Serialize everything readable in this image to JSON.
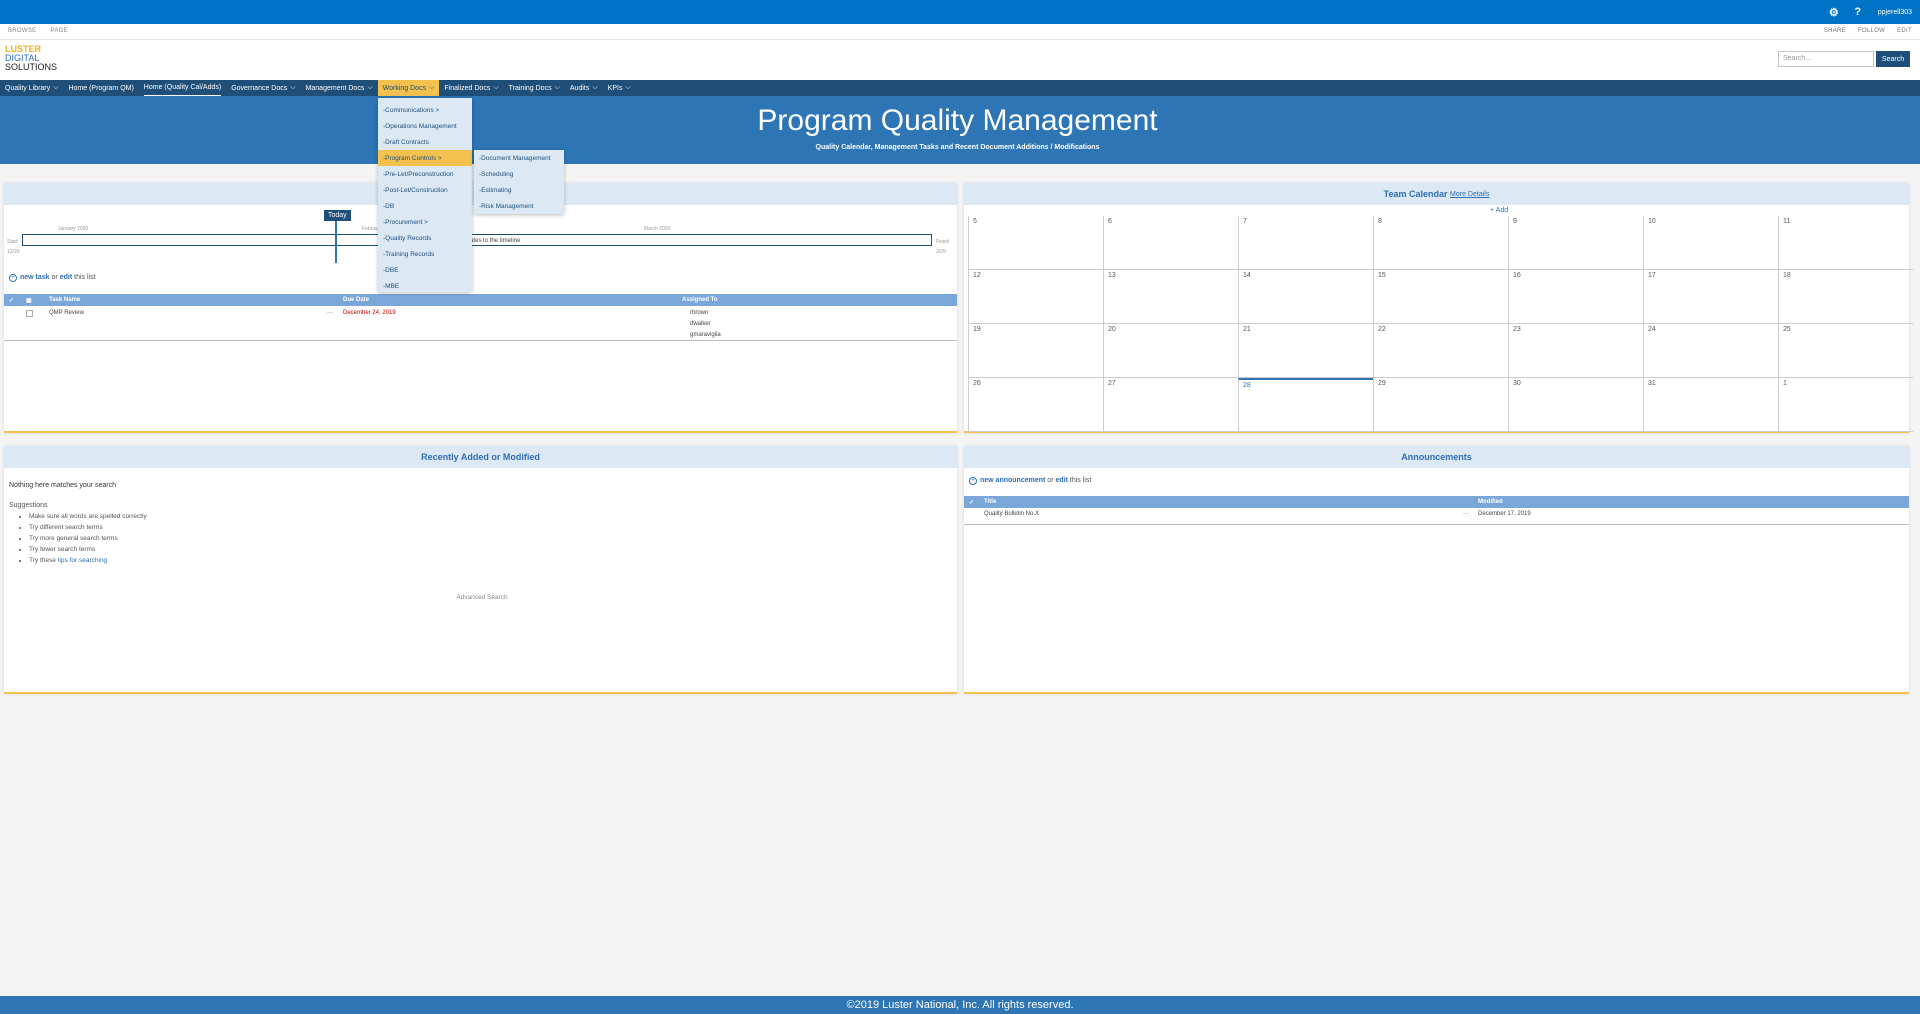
{
  "suite": {
    "settings_icon": "gear-icon",
    "help_icon": "?",
    "user": "ppjerell303"
  },
  "ribbon": {
    "tabs": [
      "BROWSE",
      "PAGE"
    ],
    "actions": [
      "SHARE",
      "FOLLOW",
      "EDIT"
    ]
  },
  "logo": {
    "line1": "LUSTER",
    "line2": "DIGITAL",
    "line3": "SOLUTIONS"
  },
  "search": {
    "placeholder": "Search...",
    "button": "Search"
  },
  "nav": {
    "items": [
      {
        "label": "Quality Library",
        "chevron": true
      },
      {
        "label": "Home (Program QM)",
        "chevron": false
      },
      {
        "label": "Home (Quality Cal/Adds)",
        "chevron": false
      },
      {
        "label": "Governance Docs",
        "chevron": true
      },
      {
        "label": "Management Docs",
        "chevron": true
      },
      {
        "label": "Working Docs",
        "chevron": true
      },
      {
        "label": "Finalized Docs",
        "chevron": true
      },
      {
        "label": "Training Docs",
        "chevron": true
      },
      {
        "label": "Audits",
        "chevron": true
      },
      {
        "label": "KPIs",
        "chevron": true
      }
    ]
  },
  "banner": {
    "title": "Program Quality Management",
    "subtitle": "Quality Calendar, Management Tasks and Recent Document Additions / Modifications"
  },
  "dropdown": {
    "items": [
      "-Communications >",
      "-Operations Management",
      "-Draft Contracts",
      "-Program Controls >",
      "-Pre-Let/Preconstruction",
      "-Post-Let/Construction",
      "-DB",
      "-Procurement >",
      "-Quality Records",
      "-Training Records",
      "-DBE",
      "-MBE"
    ],
    "highlighted": "-Program Controls >"
  },
  "submenu": {
    "items": [
      "-Document Management",
      "-Scheduling",
      "-Estimating",
      "-Risk Management"
    ]
  },
  "tasks": {
    "timeline": {
      "today": "Today",
      "months": [
        "January 2020",
        "February",
        "March 2020"
      ],
      "start_label": "Start",
      "start_date": "12/29",
      "finish_label": "Finish",
      "finish_date": "3/29",
      "hint": "ates to the timeline"
    },
    "new_task": "new task",
    "or": "or",
    "edit": "edit",
    "this_list": "this list",
    "columns": [
      "Task Name",
      "Due Date",
      "Assigned To"
    ],
    "rows": [
      {
        "name": "QMP Review",
        "dots": "···",
        "due": "December 24, 2019",
        "assigned": [
          "rbrown",
          "dwalker",
          "gmaravigila"
        ]
      }
    ]
  },
  "calendar": {
    "title": "Team Calendar",
    "more": "More Details",
    "add": "+ Add",
    "weeks": [
      [
        "5",
        "6",
        "7",
        "8",
        "9",
        "10",
        "11"
      ],
      [
        "12",
        "13",
        "14",
        "15",
        "16",
        "17",
        "18"
      ],
      [
        "19",
        "20",
        "21",
        "22",
        "23",
        "24",
        "25"
      ],
      [
        "26",
        "27",
        "28",
        "29",
        "30",
        "31",
        "1"
      ]
    ],
    "today": "28"
  },
  "recent": {
    "title": "Recently Added or Modified",
    "nothing": "Nothing here matches your search",
    "suggestions_label": "Suggestions",
    "suggestions": [
      "Make sure all words are spelled correctly",
      "Try different search terms",
      "Try more general search terms",
      "Try fewer search terms"
    ],
    "tips_prefix": "Try these",
    "tips_link": "tips for searching",
    "advanced": "Advanced Search"
  },
  "announcements": {
    "title": "Announcements",
    "new": "new announcement",
    "or": "or",
    "edit": "edit",
    "this_list": "this list",
    "columns": [
      "Title",
      "Modified"
    ],
    "rows": [
      {
        "title": "Quality Bulletin No.X",
        "dots": "···",
        "modified": "December 17, 2019"
      }
    ]
  },
  "footer": {
    "text": "©2019 Luster National, Inc. All rights reserved."
  },
  "colors": {
    "suite_bar": "#0072c6",
    "nav": "#1f4e79",
    "banner": "#2e75b6",
    "accent": "#f2c14e",
    "panel_head": "#dce9f5"
  }
}
